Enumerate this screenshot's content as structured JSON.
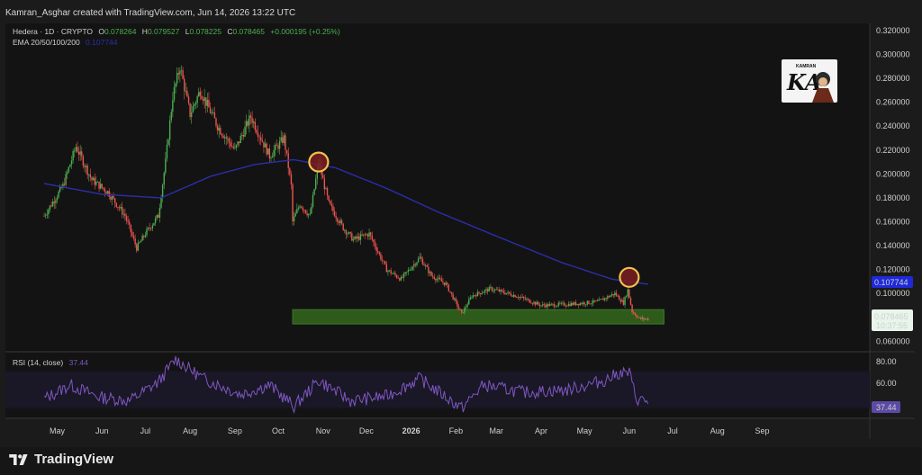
{
  "credit": "Kamran_Asghar created with TradingView.com, Jun 14, 2026 13:22 UTC",
  "legend": {
    "symbol": "Hedera · 1D · CRYPTO",
    "o_label": "O",
    "o_value": "0.078264",
    "h_label": "H",
    "h_value": "0.079527",
    "l_label": "L",
    "l_value": "0.078225",
    "c_label": "C",
    "c_value": "0.078465",
    "change": "+0.000195 (+0.25%)",
    "ema_label": "EMA 20/50/100/200",
    "ema_value": "0.107744"
  },
  "watermark": {
    "text": "KA",
    "top_text": "KAMRAN"
  },
  "rsi": {
    "label": "RSI (14, close)",
    "value": "37.44",
    "ticks": [
      "80.00",
      "60.00",
      "40.00"
    ],
    "current_label": "37.44"
  },
  "price_labels": {
    "ema": "0.107744",
    "last": "0.078465",
    "countdown": "10:37:55"
  },
  "footer": {
    "brand": "TradingView"
  },
  "colors": {
    "up": "#26a69a",
    "up_bright": "#4caf50",
    "down": "#ef5350",
    "ema": "#2a2fa8",
    "rsi": "#7e57c2",
    "zone": "#2e5a1c",
    "circle_fill": "#7a1e22",
    "circle_stroke": "#f2c14e",
    "ema_label_bg": "#1e2ad8"
  },
  "chart_data": {
    "type": "candlestick",
    "title": "Hedera · 1D · CRYPTO",
    "y_ticks": [
      "0.320000",
      "0.300000",
      "0.280000",
      "0.260000",
      "0.240000",
      "0.220000",
      "0.200000",
      "0.180000",
      "0.160000",
      "0.140000",
      "0.120000",
      "0.100000",
      "0.080000",
      "0.060000"
    ],
    "ylim": [
      0.052,
      0.326
    ],
    "x_ticks": [
      "May",
      "Jun",
      "Jul",
      "Aug",
      "Sep",
      "Oct",
      "Nov",
      "Dec",
      "2026",
      "Feb",
      "Mar",
      "Apr",
      "May",
      "Jun",
      "Jul",
      "Aug",
      "Sep"
    ],
    "price_path": [
      [
        "2025-04-22",
        0.165
      ],
      [
        "2025-05-05",
        0.19
      ],
      [
        "2025-05-14",
        0.223
      ],
      [
        "2025-05-25",
        0.195
      ],
      [
        "2025-06-05",
        0.185
      ],
      [
        "2025-06-17",
        0.165
      ],
      [
        "2025-06-25",
        0.138
      ],
      [
        "2025-07-01",
        0.15
      ],
      [
        "2025-07-10",
        0.165
      ],
      [
        "2025-07-15",
        0.21
      ],
      [
        "2025-07-20",
        0.265
      ],
      [
        "2025-07-25",
        0.29
      ],
      [
        "2025-08-01",
        0.25
      ],
      [
        "2025-08-08",
        0.27
      ],
      [
        "2025-08-20",
        0.24
      ],
      [
        "2025-09-01",
        0.22
      ],
      [
        "2025-09-12",
        0.248
      ],
      [
        "2025-09-25",
        0.215
      ],
      [
        "2025-10-05",
        0.23
      ],
      [
        "2025-10-10",
        0.19
      ],
      [
        "2025-10-11",
        0.16
      ],
      [
        "2025-10-16",
        0.175
      ],
      [
        "2025-10-23",
        0.165
      ],
      [
        "2025-10-29",
        0.21
      ],
      [
        "2025-11-05",
        0.175
      ],
      [
        "2025-11-15",
        0.155
      ],
      [
        "2025-11-22",
        0.145
      ],
      [
        "2025-12-03",
        0.15
      ],
      [
        "2025-12-15",
        0.12
      ],
      [
        "2025-12-25",
        0.112
      ],
      [
        "2026-01-07",
        0.13
      ],
      [
        "2026-01-15",
        0.115
      ],
      [
        "2026-01-25",
        0.108
      ],
      [
        "2026-02-05",
        0.083
      ],
      [
        "2026-02-12",
        0.098
      ],
      [
        "2026-02-25",
        0.104
      ],
      [
        "2026-03-15",
        0.098
      ],
      [
        "2026-04-01",
        0.09
      ],
      [
        "2026-04-20",
        0.091
      ],
      [
        "2026-05-10",
        0.093
      ],
      [
        "2026-05-22",
        0.1
      ],
      [
        "2026-05-28",
        0.092
      ],
      [
        "2026-05-31",
        0.103
      ],
      [
        "2026-06-03",
        0.085
      ],
      [
        "2026-06-08",
        0.079
      ],
      [
        "2026-06-14",
        0.0785
      ]
    ],
    "ema_200": [
      [
        "2025-04-22",
        0.192
      ],
      [
        "2025-06-01",
        0.183
      ],
      [
        "2025-07-12",
        0.18
      ],
      [
        "2025-08-15",
        0.198
      ],
      [
        "2025-09-15",
        0.208
      ],
      [
        "2025-10-12",
        0.212
      ],
      [
        "2025-11-10",
        0.205
      ],
      [
        "2025-12-15",
        0.188
      ],
      [
        "2026-01-20",
        0.168
      ],
      [
        "2026-03-01",
        0.148
      ],
      [
        "2026-04-15",
        0.126
      ],
      [
        "2026-05-20",
        0.112
      ],
      [
        "2026-06-14",
        0.1077
      ]
    ],
    "support_zone": {
      "from": "2025-10-11",
      "to": "2026-06-25",
      "low": 0.0745,
      "high": 0.0865
    },
    "markers": [
      {
        "date": "2025-10-29",
        "price": 0.21
      },
      {
        "date": "2026-06-01",
        "price": 0.1135
      }
    ],
    "rsi_ylim": [
      20,
      90
    ],
    "rsi_path": [
      [
        "2025-04-22",
        40
      ],
      [
        "2025-05-10",
        55
      ],
      [
        "2025-05-30",
        42
      ],
      [
        "2025-06-20",
        38
      ],
      [
        "2025-07-10",
        58
      ],
      [
        "2025-07-22",
        83
      ],
      [
        "2025-08-10",
        62
      ],
      [
        "2025-09-05",
        45
      ],
      [
        "2025-09-25",
        55
      ],
      [
        "2025-10-12",
        32
      ],
      [
        "2025-10-29",
        60
      ],
      [
        "2025-11-20",
        38
      ],
      [
        "2025-12-15",
        43
      ],
      [
        "2026-01-07",
        62
      ],
      [
        "2026-02-05",
        30
      ],
      [
        "2026-02-20",
        55
      ],
      [
        "2026-03-20",
        47
      ],
      [
        "2026-04-20",
        50
      ],
      [
        "2026-05-15",
        60
      ],
      [
        "2026-05-25",
        68
      ],
      [
        "2026-06-01",
        68
      ],
      [
        "2026-06-06",
        40
      ],
      [
        "2026-06-14",
        37.44
      ]
    ]
  }
}
